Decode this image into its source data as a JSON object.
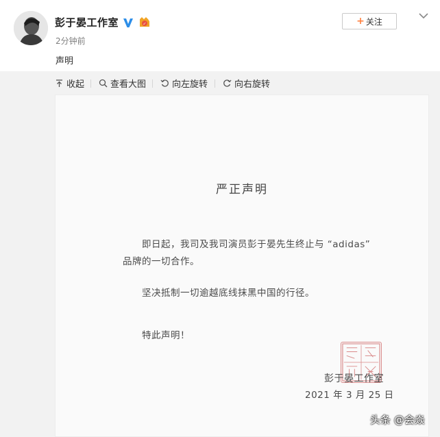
{
  "post": {
    "author": "彭于晏工作室",
    "time": "2分钟前",
    "text": "声明",
    "follow_label": "关注",
    "follow_plus": "+"
  },
  "toolbar": {
    "collapse": "收起",
    "view_large": "查看大图",
    "rotate_left": "向左旋转",
    "rotate_right": "向右旋转"
  },
  "document": {
    "title": "严正声明",
    "para1_line1": "即日起，我司及我司演员彭于晏先生终止与 “adidas”",
    "para1_line2": "品牌的一切合作。",
    "para2": "坚决抵制一切逾越底线抹黑中国的行径。",
    "para3": "特此声明！",
    "signature": "彭于晏工作室",
    "date": "2021 年 3 月 25 日"
  },
  "watermark": {
    "label": "头条 @会焱"
  },
  "colors": {
    "accent_orange": "#ff8140",
    "verified_blue": "#2d8ee8",
    "seal_red": "#d98a8a"
  }
}
